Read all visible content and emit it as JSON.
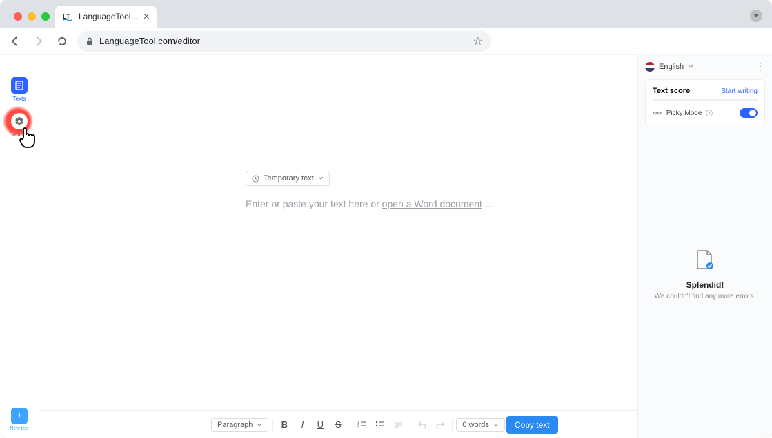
{
  "browser": {
    "tab_title": "LanguageTool...",
    "url": "LanguageTool.com/editor"
  },
  "left_rail": {
    "texts_label": "Texts",
    "settings_label": "Settings",
    "new_text_label": "New text"
  },
  "editor": {
    "temp_chip": "Temporary text",
    "placeholder_prefix": "Enter or paste your text here or ",
    "placeholder_link": "open a Word document",
    "placeholder_suffix": " …"
  },
  "toolbar": {
    "paragraph_label": "Paragraph",
    "word_count": "0 words",
    "copy_label": "Copy text"
  },
  "right_panel": {
    "language": "English",
    "score_title": "Text score",
    "start_writing": "Start writing",
    "picky_label": "Picky Mode",
    "splendid_title": "Splendid!",
    "splendid_msg": "We couldn't find any more errors."
  }
}
